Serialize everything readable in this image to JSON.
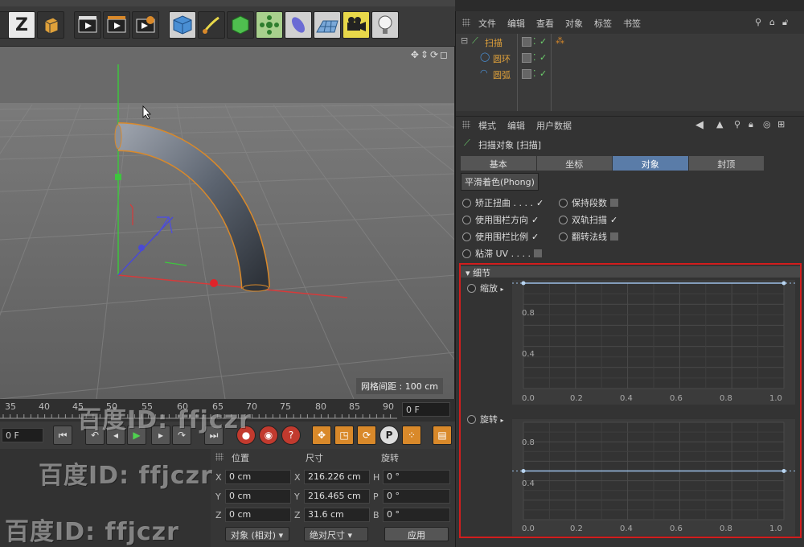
{
  "viewport": {
    "grid_label": "网格间距 : 100 cm"
  },
  "timeline": {
    "ticks": [
      "35",
      "40",
      "45",
      "50",
      "55",
      "60",
      "65",
      "70",
      "75",
      "80",
      "85",
      "90"
    ],
    "frame": "0 F"
  },
  "playback": {
    "frame": "0 F"
  },
  "object_manager": {
    "menu": [
      "文件",
      "编辑",
      "查看",
      "对象",
      "标签",
      "书签"
    ],
    "objects": [
      {
        "name": "扫描"
      },
      {
        "name": "圆环"
      },
      {
        "name": "圆弧"
      }
    ]
  },
  "attribute_manager": {
    "menu": [
      "模式",
      "编辑",
      "用户数据"
    ],
    "title": "扫描对象 [扫描]",
    "tabs": [
      "基本",
      "坐标",
      "对象",
      "封顶"
    ],
    "active_tab": "对象",
    "sub_button": "平滑着色(Phong)",
    "options_left": [
      "矫正扭曲 . . . .",
      "使用围栏方向",
      "使用围栏比例",
      "粘滞 UV . . . ."
    ],
    "options_right": [
      "保持段数",
      "双轨扫描",
      "翻转法线"
    ],
    "checkmark": "✓",
    "detail": {
      "header": "▾ 细节",
      "scale_label": "缩放",
      "rotate_label": "旋转",
      "scale_y_ticks": [
        "0.8",
        "0.4",
        "0.0"
      ],
      "rotate_y_ticks": [
        "0.8",
        "0.4",
        "0.0"
      ],
      "x_ticks": [
        "0.2",
        "0.4",
        "0.6",
        "0.8",
        "1.0"
      ],
      "scale_curve": [
        [
          0,
          1.0
        ],
        [
          1,
          1.0
        ]
      ],
      "rotate_curve": [
        [
          0,
          0.5
        ],
        [
          1,
          0.5
        ]
      ]
    }
  },
  "coordinates": {
    "headers": [
      "位置",
      "尺寸",
      "旋转"
    ],
    "rows": [
      {
        "axis": "X",
        "pos": "0 cm",
        "size_axis": "X",
        "size": "216.226 cm",
        "rot_axis": "H",
        "rot": "0 °"
      },
      {
        "axis": "Y",
        "pos": "0 cm",
        "size_axis": "Y",
        "size": "216.465 cm",
        "rot_axis": "P",
        "rot": "0 °"
      },
      {
        "axis": "Z",
        "pos": "0 cm",
        "size_axis": "Z",
        "size": "31.6 cm",
        "rot_axis": "B",
        "rot": "0 °"
      }
    ],
    "mode_select": "对象 (相对) ▾",
    "size_select": "绝对尺寸 ▾",
    "apply": "应用"
  },
  "watermark": "百度ID: ffjczr",
  "colors": {
    "accent_tab": "#5a7ca8",
    "highlight_frame": "#d21d1d",
    "object_name": "#e0a13a",
    "check_green": "#6cd06c"
  }
}
